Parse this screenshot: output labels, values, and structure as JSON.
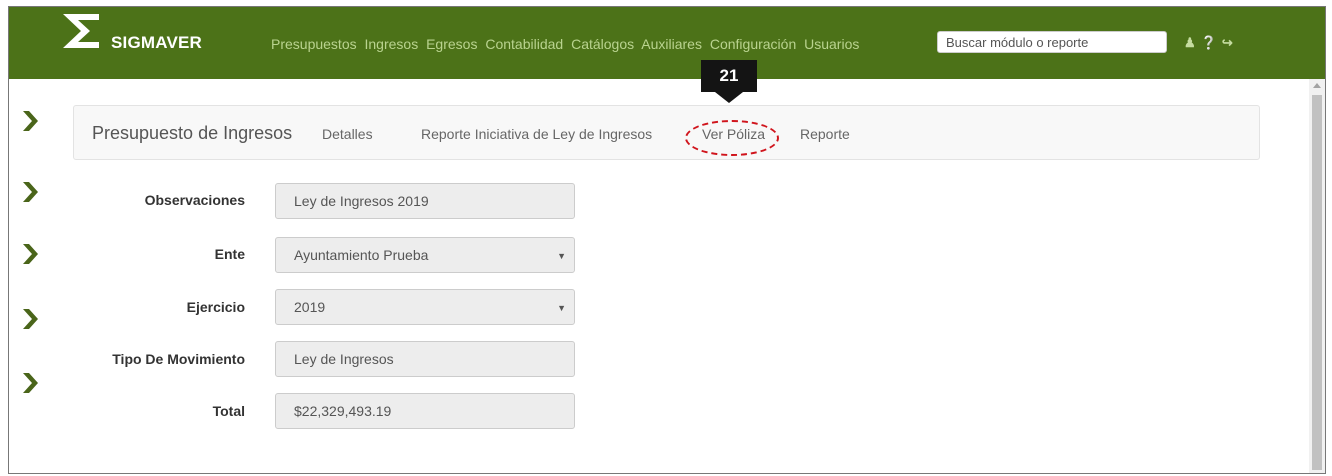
{
  "app": {
    "brand": "SIGMAVER"
  },
  "nav": {
    "menu": [
      "Presupuestos",
      "Ingresos",
      "Egresos",
      "Contabilidad",
      "Catálogos",
      "Auxiliares",
      "Configuración",
      "Usuarios"
    ],
    "search_placeholder": "Buscar módulo o reporte",
    "icons": [
      "user-icon",
      "help-icon",
      "logout-icon"
    ]
  },
  "panel": {
    "title": "Presupuesto de Ingresos",
    "links": [
      "Detalles",
      "Reporte Iniciativa de Ley de Ingresos",
      "Ver Póliza",
      "Reporte"
    ]
  },
  "annotation": {
    "step": "21"
  },
  "form": {
    "observaciones": {
      "label": "Observaciones",
      "value": "Ley de Ingresos 2019"
    },
    "ente": {
      "label": "Ente",
      "value": "Ayuntamiento Prueba"
    },
    "ejercicio": {
      "label": "Ejercicio",
      "value": "2019"
    },
    "tipo": {
      "label": "Tipo De Movimiento",
      "value": "Ley de Ingresos"
    },
    "total": {
      "label": "Total",
      "value": "$22,329,493.19"
    }
  },
  "colors": {
    "navbar": "#4c7218",
    "menu_text": "#b9d38f",
    "arrow": "#4a651a",
    "highlight": "#d0141c"
  }
}
